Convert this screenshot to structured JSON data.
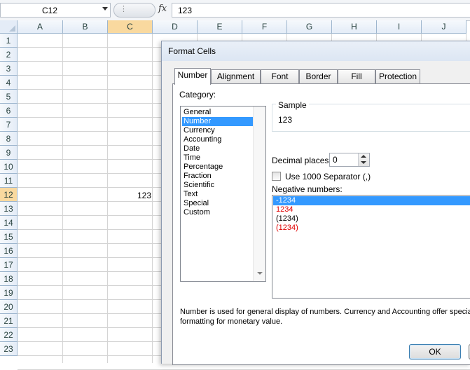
{
  "formula_bar": {
    "name_box": "C12",
    "fx_label": "fx",
    "formula": "123"
  },
  "sheet": {
    "columns": [
      "A",
      "B",
      "C",
      "D",
      "E",
      "F",
      "G",
      "H",
      "I",
      "J"
    ],
    "rows": [
      "1",
      "2",
      "3",
      "4",
      "5",
      "6",
      "7",
      "8",
      "9",
      "10",
      "11",
      "12",
      "13",
      "14",
      "15",
      "16",
      "17",
      "18",
      "19",
      "20",
      "21",
      "22",
      "23"
    ],
    "active_cell": "C12",
    "active_cell_value": "123"
  },
  "dialog": {
    "title": "Format Cells",
    "tabs": [
      "Number",
      "Alignment",
      "Font",
      "Border",
      "Fill",
      "Protection"
    ],
    "active_tab": "Number",
    "category_label": "Category:",
    "categories": [
      "General",
      "Number",
      "Currency",
      "Accounting",
      "Date",
      "Time",
      "Percentage",
      "Fraction",
      "Scientific",
      "Text",
      "Special",
      "Custom"
    ],
    "selected_category": "Number",
    "sample_label": "Sample",
    "sample_value": "123",
    "decimal_places_label": "Decimal places:",
    "decimal_places_value": "0",
    "use_separator_label": "Use 1000 Separator (,)",
    "use_separator_checked": false,
    "negative_numbers_label": "Negative numbers:",
    "negative_numbers": [
      {
        "text": "-1234",
        "selected": true,
        "red": false
      },
      {
        "text": "1234",
        "selected": false,
        "red": true
      },
      {
        "text": "(1234)",
        "selected": false,
        "red": false
      },
      {
        "text": "(1234)",
        "selected": false,
        "red": true
      }
    ],
    "description_line1": "Number is used for general display of numbers.  Currency and Accounting offer speciali",
    "description_line2": "formatting for monetary value.",
    "ok_label": "OK"
  },
  "colors": {
    "selection": "#3399ff",
    "negative_red": "#e00000",
    "header_selected": "#f9d99f"
  }
}
